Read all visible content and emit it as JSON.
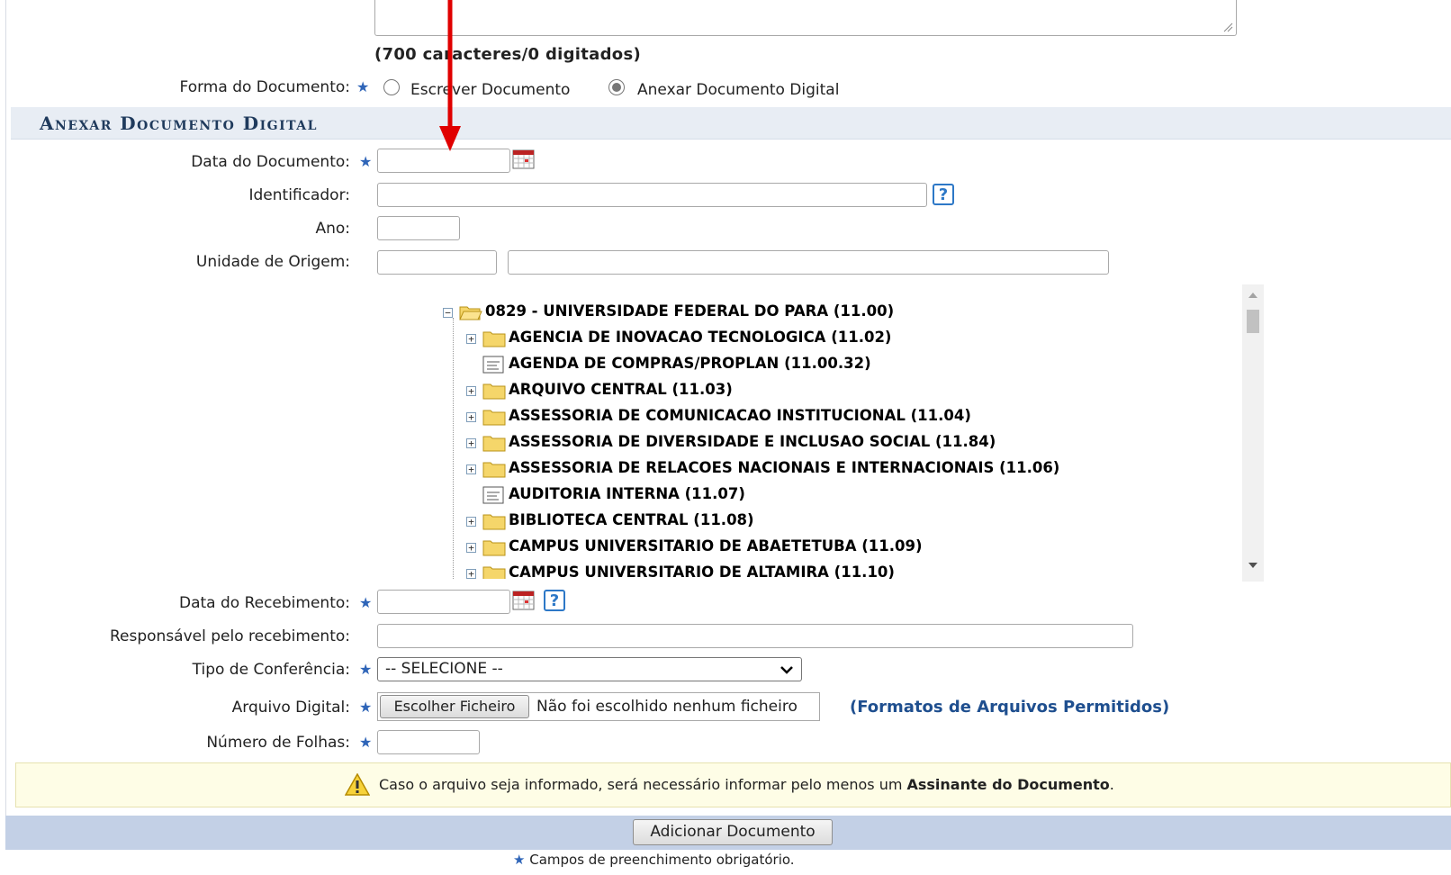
{
  "form": {
    "char_counter": "(700 caracteres/0 digitados)",
    "forma_documento": {
      "label": "Forma do Documento:",
      "options": [
        "Escrever Documento",
        "Anexar Documento Digital"
      ],
      "selected": "Anexar Documento Digital"
    },
    "section_title": "Anexar Documento Digital",
    "data_documento": {
      "label": "Data do Documento:",
      "value": ""
    },
    "identificador": {
      "label": "Identificador:",
      "value": ""
    },
    "ano": {
      "label": "Ano:",
      "value": ""
    },
    "unidade_origem": {
      "label": "Unidade de Origem:",
      "code": "",
      "name": ""
    },
    "tree": {
      "root": "0829 - UNIVERSIDADE FEDERAL DO PARA (11.00)",
      "items": [
        {
          "label": "AGENCIA DE INOVACAO TECNOLOGICA (11.02)",
          "kind": "folder"
        },
        {
          "label": "AGENDA DE COMPRAS/PROPLAN (11.00.32)",
          "kind": "leaf"
        },
        {
          "label": "ARQUIVO CENTRAL (11.03)",
          "kind": "folder"
        },
        {
          "label": "ASSESSORIA DE COMUNICACAO INSTITUCIONAL (11.04)",
          "kind": "folder"
        },
        {
          "label": "ASSESSORIA DE DIVERSIDADE E INCLUSAO SOCIAL (11.84)",
          "kind": "folder"
        },
        {
          "label": "ASSESSORIA DE RELACOES NACIONAIS E INTERNACIONAIS (11.06)",
          "kind": "folder"
        },
        {
          "label": "AUDITORIA INTERNA (11.07)",
          "kind": "leaf"
        },
        {
          "label": "BIBLIOTECA CENTRAL (11.08)",
          "kind": "folder"
        },
        {
          "label": "CAMPUS UNIVERSITARIO DE ABAETETUBA (11.09)",
          "kind": "folder"
        },
        {
          "label": "CAMPUS UNIVERSITARIO DE ALTAMIRA (11.10)",
          "kind": "folder"
        }
      ]
    },
    "data_recebimento": {
      "label": "Data do Recebimento:",
      "value": ""
    },
    "responsavel": {
      "label": "Responsável pelo recebimento:",
      "value": ""
    },
    "tipo_conferencia": {
      "label": "Tipo de Conferência:",
      "selected": "-- SELECIONE --"
    },
    "arquivo_digital": {
      "label": "Arquivo Digital:",
      "button": "Escolher Ficheiro",
      "status": "Não foi escolhido nenhum ficheiro",
      "formats_link": "(Formatos de Arquivos Permitidos)"
    },
    "numero_folhas": {
      "label": "Número de Folhas:",
      "value": ""
    },
    "notice": {
      "text": "Caso o arquivo seja informado, será necessário informar pelo menos um ",
      "bold": "Assinante do Documento",
      "end": "."
    },
    "submit_label": "Adicionar Documento",
    "required_note": "Campos de preenchimento obrigatório."
  },
  "colors": {
    "accent_red_arrow": "#e00000",
    "required_star": "#2f65b8",
    "footer": "#c3d0e6"
  }
}
